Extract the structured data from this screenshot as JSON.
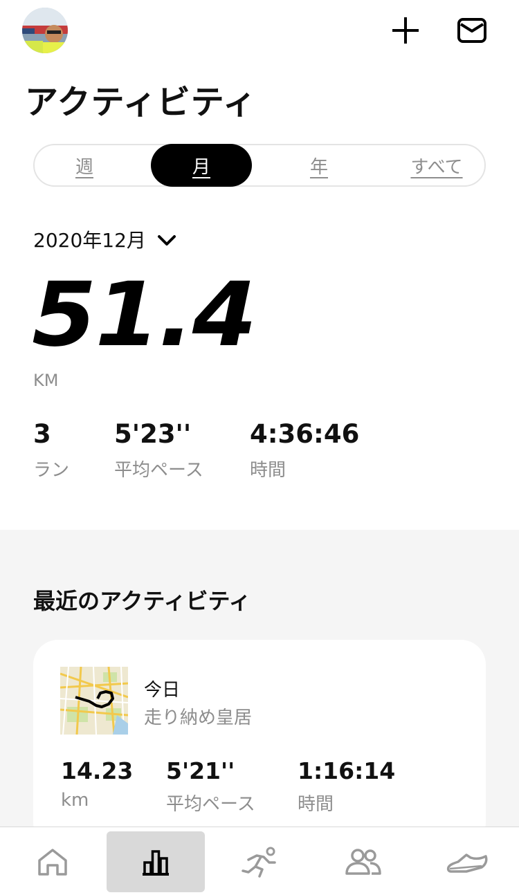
{
  "header": {
    "avatar_icon": "user-avatar",
    "add_icon": "plus-icon",
    "inbox_icon": "mail-icon",
    "title": "アクティビティ"
  },
  "segments": {
    "week": "週",
    "month": "月",
    "year": "年",
    "all": "すべて",
    "selected": "month"
  },
  "summary": {
    "period": "2020年12月",
    "distance": "51.4",
    "distance_unit": "KM",
    "runs_value": "3",
    "runs_label": "ラン",
    "pace_value": "5'23''",
    "pace_label": "平均ペース",
    "time_value": "4:36:46",
    "time_label": "時間"
  },
  "recent": {
    "title": "最近のアクティビティ",
    "activity": {
      "date": "今日",
      "name": "走り納め皇居",
      "distance_value": "14.23",
      "distance_unit": "km",
      "pace_value": "5'21''",
      "pace_label": "平均ペース",
      "time_value": "1:16:14",
      "time_label": "時間"
    }
  },
  "tabbar": {
    "items": [
      "home-icon",
      "activity-chart-icon",
      "run-club-icon",
      "community-icon",
      "shoe-icon"
    ],
    "active": "activity-chart-icon",
    "active_bg": "#d9d9d9"
  },
  "colors": {
    "accent": "#000000",
    "secondary_text": "#8d8d8d",
    "section_bg": "#f5f5f5"
  }
}
